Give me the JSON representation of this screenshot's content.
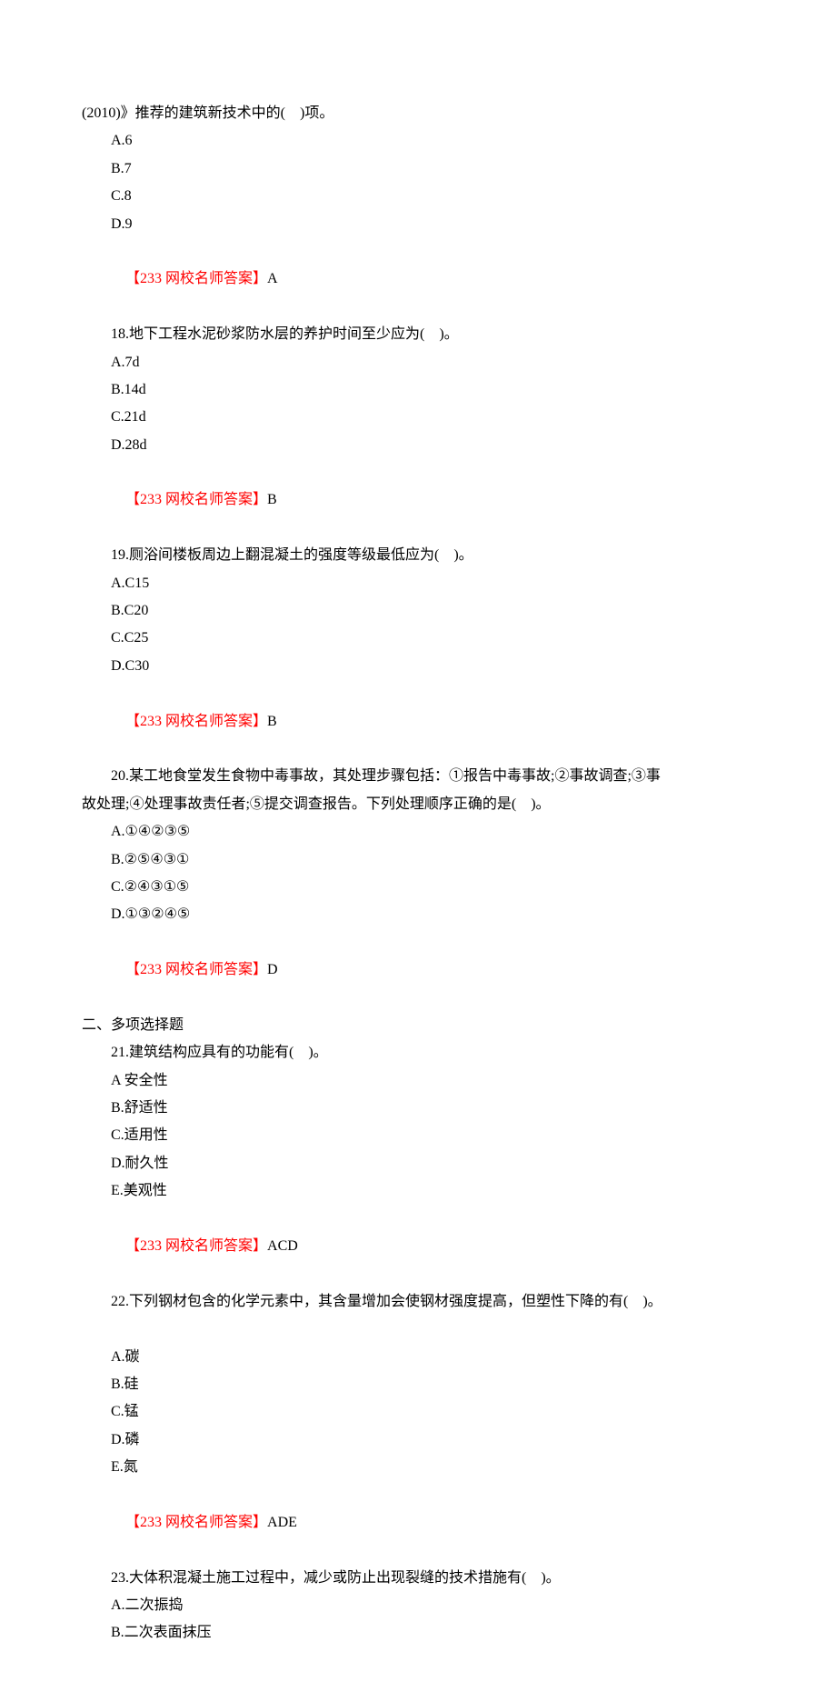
{
  "header_line": "(2010)》推荐的建筑新技术中的(    )项。",
  "q17": {
    "a": "A.6",
    "b": "B.7",
    "c": "C.8",
    "d": "D.9",
    "ans_label": "【233 网校名师答案】",
    "ans_value": "A"
  },
  "q18": {
    "stem": "18.地下工程水泥砂浆防水层的养护时间至少应为(    )。",
    "a": "A.7d",
    "b": "B.14d",
    "c": "C.21d",
    "d": "D.28d",
    "ans_label": "【233 网校名师答案】",
    "ans_value": "B"
  },
  "q19": {
    "stem": "19.厕浴间楼板周边上翻混凝土的强度等级最低应为(    )。",
    "a": "A.C15",
    "b": "B.C20",
    "c": "C.C25",
    "d": "D.C30",
    "ans_label": "【233 网校名师答案】",
    "ans_value": "B"
  },
  "q20": {
    "stem_l1": "20.某工地食堂发生食物中毒事故，其处理步骤包括：①报告中毒事故;②事故调查;③事",
    "stem_l2": "故处理;④处理事故责任者;⑤提交调查报告。下列处理顺序正确的是(    )。",
    "a": "A.①④②③⑤",
    "b": "B.②⑤④③①",
    "c": "C.②④③①⑤",
    "d": "D.①③②④⑤",
    "ans_label": "【233 网校名师答案】",
    "ans_value": "D"
  },
  "section2": "二、多项选择题",
  "q21": {
    "stem": "21.建筑结构应具有的功能有(    )。",
    "a": "A 安全性",
    "b": "B.舒适性",
    "c": "C.适用性",
    "d": "D.耐久性",
    "e": "E.美观性",
    "ans_label": "【233 网校名师答案】",
    "ans_value": "ACD"
  },
  "q22": {
    "stem": "22.下列钢材包含的化学元素中，其含量增加会使钢材强度提高，但塑性下降的有(    )。",
    "a": "A.碳",
    "b": "B.硅",
    "c": "C.锰",
    "d": "D.磷",
    "e": "E.氮",
    "ans_label": "【233 网校名师答案】",
    "ans_value": "ADE"
  },
  "q23": {
    "stem": "23.大体积混凝土施工过程中，减少或防止出现裂缝的技术措施有(    )。",
    "a": "A.二次振捣",
    "b": "B.二次表面抹压"
  }
}
